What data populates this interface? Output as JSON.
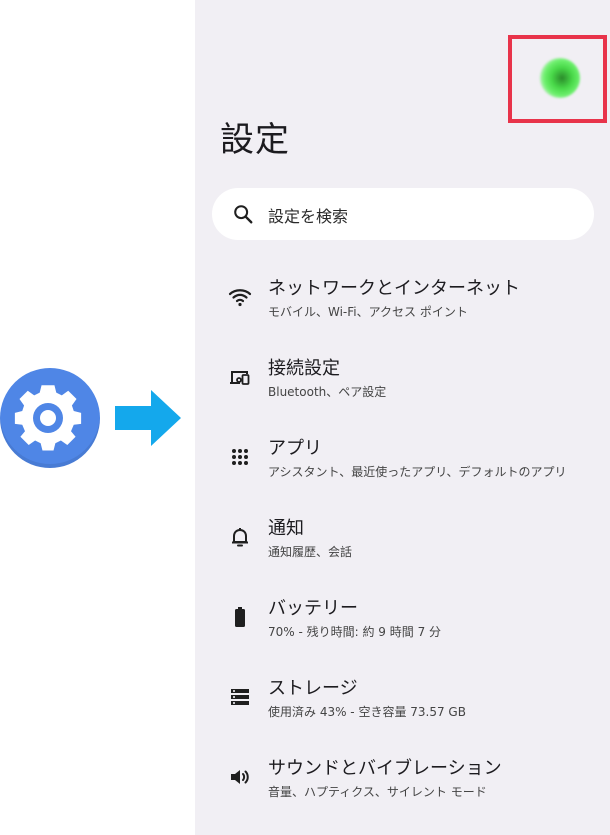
{
  "title": "設定",
  "search": {
    "placeholder": "設定を検索"
  },
  "items": [
    {
      "title": "ネットワークとインターネット",
      "subtitle": "モバイル、Wi-Fi、アクセス ポイント",
      "icon": "wifi-icon"
    },
    {
      "title": "接続設定",
      "subtitle": "Bluetooth、ペア設定",
      "icon": "connected-devices-icon"
    },
    {
      "title": "アプリ",
      "subtitle": "アシスタント、最近使ったアプリ、デフォルトのアプリ",
      "icon": "apps-grid-icon"
    },
    {
      "title": "通知",
      "subtitle": "通知履歴、会話",
      "icon": "bell-icon"
    },
    {
      "title": "バッテリー",
      "subtitle": "70% - 残り時間: 約 9 時間 7 分",
      "icon": "battery-icon"
    },
    {
      "title": "ストレージ",
      "subtitle": "使用済み 43% - 空き容量 73.57 GB",
      "icon": "storage-icon"
    },
    {
      "title": "サウンドとバイブレーション",
      "subtitle": "音量、ハプティクス、サイレント モード",
      "icon": "speaker-icon"
    }
  ],
  "colors": {
    "panel_bg": "#f1eff4",
    "settings_icon_blue": "#4f86e6",
    "arrow_blue": "#14a8ec",
    "highlight_red": "#e8334a",
    "avatar_green": "#48d848"
  },
  "battery": {
    "level": 0.7
  },
  "storage": {
    "used": 0.43
  }
}
